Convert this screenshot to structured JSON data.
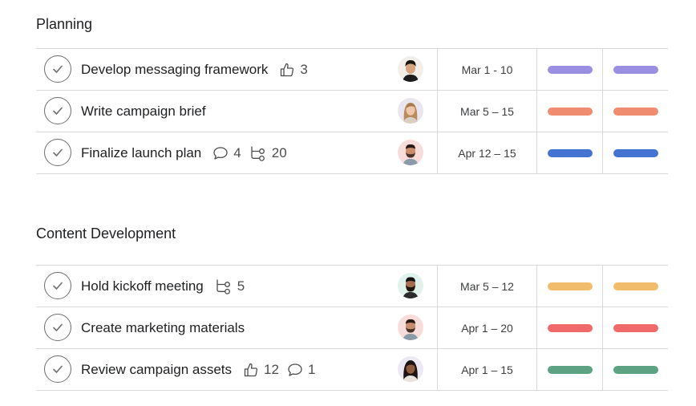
{
  "sections": [
    {
      "title": "Planning",
      "tasks": [
        {
          "name": "Develop messaging framework",
          "likes": "3",
          "comments": null,
          "subtasks": null,
          "date": "Mar 1 - 10",
          "color": "#9b8fe3",
          "avatar": "man-dark-hair"
        },
        {
          "name": "Write campaign brief",
          "likes": null,
          "comments": null,
          "subtasks": null,
          "date": "Mar 5 – 15",
          "color": "#ef8c70",
          "avatar": "woman-light-hair"
        },
        {
          "name": "Finalize launch plan",
          "likes": null,
          "comments": "4",
          "subtasks": "20",
          "date": "Apr 12 – 15",
          "color": "#4573d2",
          "avatar": "man-beard"
        }
      ]
    },
    {
      "title": "Content Development",
      "tasks": [
        {
          "name": "Hold kickoff meeting",
          "likes": null,
          "comments": null,
          "subtasks": "5",
          "date": "Mar 5 – 12",
          "color": "#f1bd6c",
          "avatar": "man-dark-beard"
        },
        {
          "name": "Create marketing materials",
          "likes": null,
          "comments": null,
          "subtasks": null,
          "date": "Apr 1 – 20",
          "color": "#f06a6a",
          "avatar": "man-beard"
        },
        {
          "name": "Review campaign assets",
          "likes": "12",
          "comments": "1",
          "subtasks": null,
          "date": "Apr 1 – 15",
          "color": "#5da283",
          "avatar": "woman-dark-hair"
        }
      ]
    }
  ]
}
